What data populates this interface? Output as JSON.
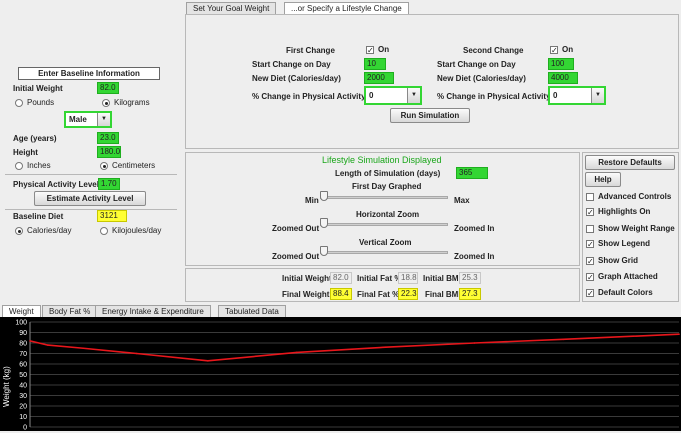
{
  "left": {
    "baseline_title": "Enter Baseline Information",
    "initial_weight_label": "Initial Weight",
    "initial_weight_value": "82.0",
    "pounds_label": "Pounds",
    "kilograms_label": "Kilograms",
    "sex_value": "Male",
    "age_label": "Age (years)",
    "age_value": "23.0",
    "height_label": "Height",
    "height_value": "180.0",
    "inches_label": "Inches",
    "centimeters_label": "Centimeters",
    "pal_label": "Physical Activity Level",
    "pal_value": "1.70",
    "estimate_button": "Estimate Activity Level",
    "baseline_diet_label": "Baseline Diet",
    "baseline_diet_value": "3121",
    "calories_label": "Calories/day",
    "kilojoules_label": "Kilojoules/day"
  },
  "top_tabs": [
    "Set Your Goal Weight",
    "...or Specify a Lifestyle Change"
  ],
  "change": {
    "first_title": "First Change",
    "second_title": "Second Change",
    "on_label": "On",
    "start_label": "Start Change on Day",
    "diet_label": "New Diet (Calories/day)",
    "activity_label": "% Change in Physical Activity",
    "first_start": "10",
    "first_diet": "2000",
    "first_activity": "0",
    "second_start": "100",
    "second_diet": "4000",
    "second_activity": "0",
    "run_button": "Run Simulation"
  },
  "sim": {
    "title": "Lifestyle Simulation Displayed",
    "length_label": "Length of Simulation (days)",
    "length_value": "365",
    "first_day_label": "First Day Graphed",
    "min_label": "Min",
    "max_label": "Max",
    "hzoom_label": "Horizontal Zoom",
    "vzoom_label": "Vertical Zoom",
    "zoomed_out_label": "Zoomed Out",
    "zoomed_in_label": "Zoomed In",
    "first_day_level": 0,
    "hzoom_level": 0,
    "vzoom_level": 0
  },
  "results": {
    "initial_weight_label": "Initial Weight",
    "initial_weight": "82.0",
    "initial_fat_label": "Initial Fat %",
    "initial_fat": "18.8",
    "initial_bmi_label": "Initial BMI",
    "initial_bmi": "25.3",
    "final_weight_label": "Final Weight",
    "final_weight": "88.4",
    "final_fat_label": "Final Fat %",
    "final_fat": "22.3",
    "final_bmi_label": "Final BMI",
    "final_bmi": "27.3"
  },
  "right": {
    "restore_button": "Restore Defaults",
    "help_button": "Help",
    "checkboxes": [
      {
        "label": "Advanced Controls",
        "checked": false
      },
      {
        "label": "Highlights On",
        "checked": true
      },
      {
        "label": "Show Weight Range",
        "checked": false
      },
      {
        "label": "Show Legend",
        "checked": true
      },
      {
        "label": "Show Grid",
        "checked": true
      },
      {
        "label": "Graph Attached",
        "checked": true
      },
      {
        "label": "Default Colors",
        "checked": true
      }
    ]
  },
  "bottom_tabs": [
    "Weight",
    "Body Fat %",
    "Energy Intake & Expenditure",
    "Tabulated Data"
  ],
  "chart_data": {
    "type": "line",
    "ylabel": "Weight (kg)",
    "ylim": [
      0,
      100
    ],
    "y_ticks": [
      0,
      10,
      20,
      30,
      40,
      50,
      60,
      70,
      80,
      90,
      100
    ],
    "x": [
      0,
      10,
      30,
      60,
      100,
      150,
      200,
      250,
      300,
      365
    ],
    "series": [
      {
        "color": "#e8161b",
        "values": [
          82.0,
          78.0,
          75.0,
          70.0,
          63.0,
          71.0,
          76.0,
          80.0,
          83.5,
          88.4
        ]
      }
    ],
    "grid": true,
    "background": "#000000"
  }
}
